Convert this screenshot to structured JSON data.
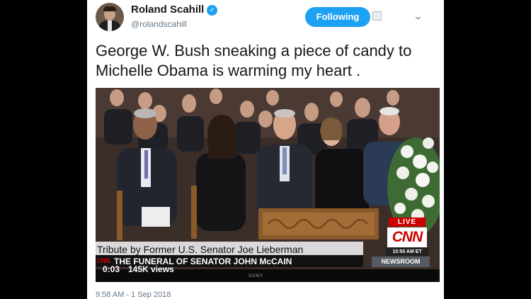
{
  "author": {
    "name": "Roland Scahill",
    "handle": "@rolandscahill",
    "verified_icon": "verified-badge-icon"
  },
  "actions": {
    "follow_label": "Following"
  },
  "tweet": {
    "text": "George W. Bush sneaking a piece of candy to Michelle Obama is warming my heart .",
    "timestamp": "9:58 AM - 1 Sep 2018"
  },
  "video": {
    "lower_third": "Tribute by Former U.S. Senator Joe Lieberman",
    "ticker_logo": "CNN",
    "headline": "THE FUNERAL OF SENATOR JOHN McCAIN",
    "elapsed": "0:03",
    "views": "145K views",
    "brand": "SONY",
    "live_label": "LIVE",
    "network_logo": "CNN",
    "et_time": "10:50 AM ET",
    "newsroom_label": "NEWSROOM"
  },
  "colors": {
    "accent": "#1da1f2",
    "cnn_red": "#cc0000",
    "background": "#000000"
  }
}
